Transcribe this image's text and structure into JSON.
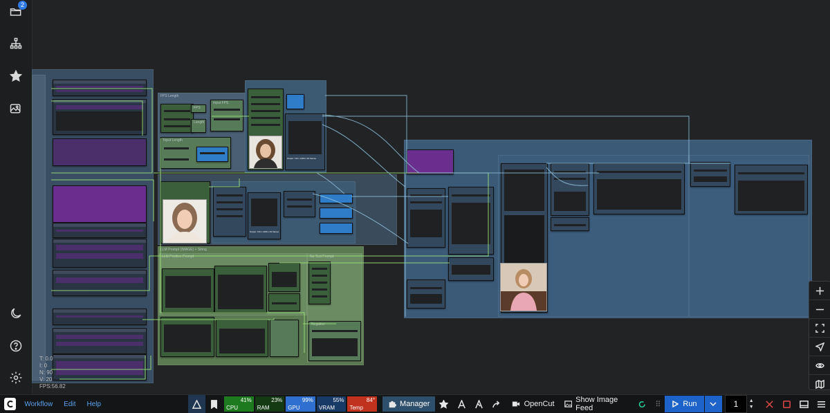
{
  "sidebar": {
    "queue_badge": "2",
    "items": [
      {
        "name": "folder-open-icon"
      },
      {
        "name": "node-tree-icon"
      },
      {
        "name": "star-icon"
      },
      {
        "name": "image-gallery-icon"
      },
      {
        "name": "moon-icon"
      },
      {
        "name": "help-icon"
      },
      {
        "name": "gear-icon"
      }
    ]
  },
  "canvas": {
    "groups": {
      "fps_length": "FPS Length",
      "input_fps": "Input FPS",
      "input_length": "Input Length",
      "fps": "FPS",
      "length": "Length",
      "llm_prompt": "LLM Prompt  (IMAGE)  + String",
      "llm_positive": "LLM Positive Prompt",
      "llm_neg": "No Text Prompt",
      "negative": "Negative",
      "preview_caption_1": "Output: 720 x 1280 x 49 frames",
      "preview_caption_2": "Output: 720 x 1280 x 49 frames"
    },
    "stats": {
      "t": "T: 0.0",
      "i": "I: 0",
      "n": "N: 90",
      "v": "V: 20",
      "fps": "FPS:56.82"
    }
  },
  "zoom_controls": [
    {
      "name": "zoom-in-icon"
    },
    {
      "name": "zoom-out-icon"
    },
    {
      "name": "fit-view-icon"
    },
    {
      "name": "locate-icon"
    },
    {
      "name": "eye-icon"
    },
    {
      "name": "map-icon"
    }
  ],
  "menu": {
    "workflow": "Workflow",
    "edit": "Edit",
    "help": "Help"
  },
  "monitors": [
    {
      "label": "CPU",
      "value": "41%",
      "color": "#1e7a1e"
    },
    {
      "label": "RAM",
      "value": "23%",
      "color": "#1e7a1e"
    },
    {
      "label": "GPU",
      "value": "99%",
      "color": "#2f6fd0"
    },
    {
      "label": "VRAM",
      "value": "55%",
      "color": "#2f6fd0"
    },
    {
      "label": "Temp",
      "value": "84°",
      "color": "#c0321e"
    }
  ],
  "toolbar": {
    "manager_label": "Manager",
    "opencut_label": "OpenCut",
    "image_feed_label": "Show Image Feed",
    "run_label": "Run",
    "queue_count": "1"
  },
  "colors": {
    "accent": "#1e63c9",
    "link_green": "#9be37a",
    "link_blue": "#7fb9d6",
    "node_purple": "#6a2f8e",
    "group_blue": "#3b5a78",
    "group_green": "#5b7a52"
  }
}
